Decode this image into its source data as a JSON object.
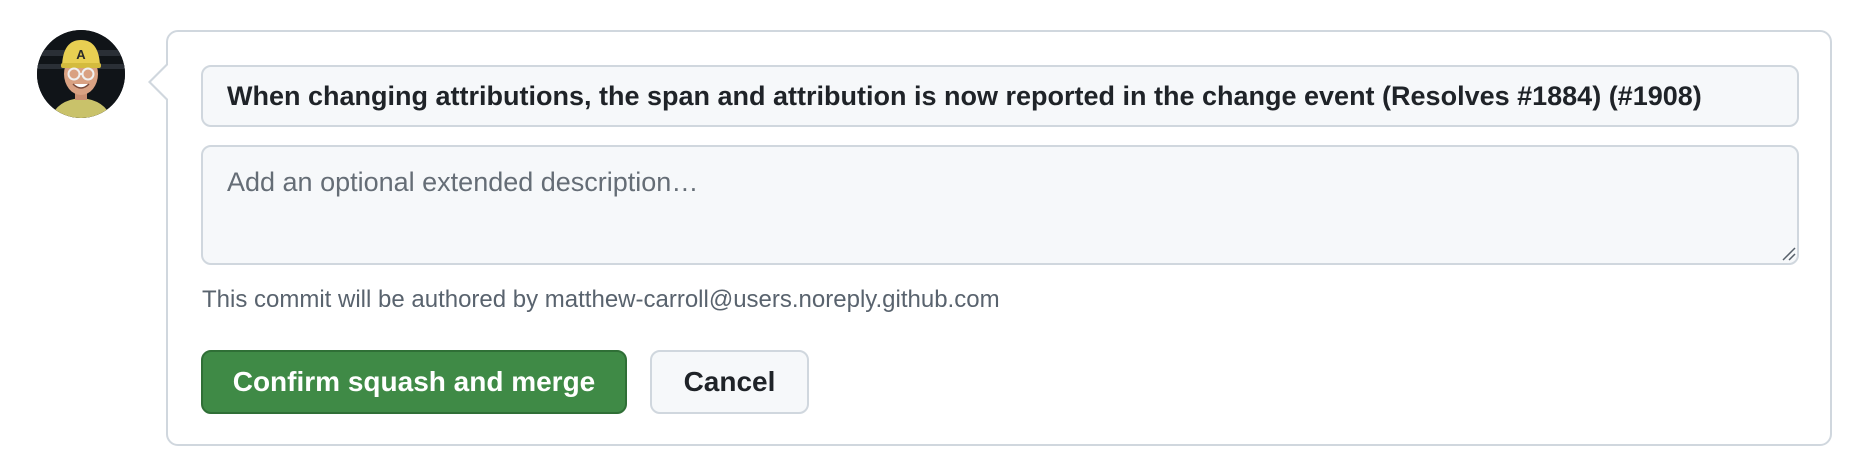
{
  "user": {
    "avatar_icon": "avatar-person-yellow-cap"
  },
  "merge_form": {
    "commit_title": "When changing attributions, the span and attribution is now reported in the change event (Resolves #1884) (#1908)",
    "description_placeholder": "Add an optional extended description…",
    "description_value": "",
    "author_note": "This commit will be authored by matthew-carroll@users.noreply.github.com",
    "confirm_label": "Confirm squash and merge",
    "cancel_label": "Cancel"
  },
  "colors": {
    "confirm_bg": "#3f8a46",
    "border": "#d0d7de",
    "input_bg": "#f6f8fa",
    "muted_text": "#59636e"
  }
}
